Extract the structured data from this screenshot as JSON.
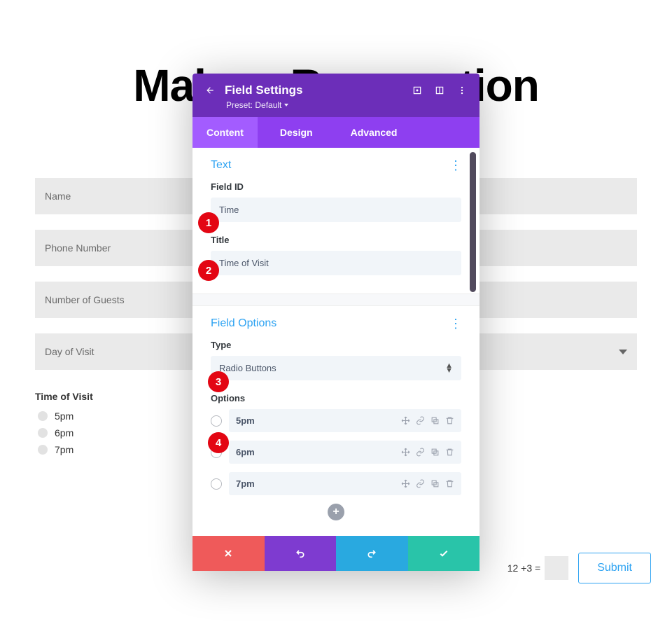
{
  "page": {
    "title": "Make a Reservation",
    "fields": {
      "name": "Name",
      "phone": "Phone Number",
      "guests": "Number of Guests",
      "day": "Day of Visit"
    },
    "time_of_visit": {
      "label": "Time of Visit",
      "options": [
        "5pm",
        "6pm",
        "7pm"
      ]
    },
    "captcha": "12 +3 =",
    "submit": "Submit"
  },
  "panel": {
    "title": "Field Settings",
    "preset": "Preset: Default",
    "tabs": {
      "content": "Content",
      "design": "Design",
      "advanced": "Advanced"
    },
    "sections": {
      "text": {
        "heading": "Text",
        "field_id_label": "Field ID",
        "field_id_value": "Time",
        "title_label": "Title",
        "title_value": "Time of Visit"
      },
      "field_options": {
        "heading": "Field Options",
        "type_label": "Type",
        "type_value": "Radio Buttons",
        "options_label": "Options",
        "options": [
          "5pm",
          "6pm",
          "7pm"
        ]
      }
    }
  },
  "badges": [
    "1",
    "2",
    "3",
    "4"
  ]
}
